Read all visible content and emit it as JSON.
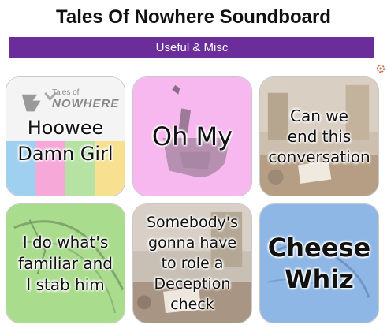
{
  "header": {
    "title": "Tales Of Nowhere Soundboard"
  },
  "category": {
    "label": "Useful & Misc"
  },
  "tiles": [
    {
      "label": "Hoowee\nDamn Girl",
      "logo_text": "Tales of",
      "logo_word": "NOWHERE"
    },
    {
      "label": "Oh My"
    },
    {
      "label": "Can we\nend this\nconversation"
    },
    {
      "label": "I do what's\nfamiliar and\nI stab him"
    },
    {
      "label": "Somebody's\ngonna have\nto role a\nDeception\ncheck"
    },
    {
      "label": "Cheese\nWhiz"
    }
  ],
  "colors": {
    "category_bar": "#6b2d9a",
    "tile_pink": "#f6b8ee",
    "tile_green": "#a9dc8c",
    "tile_blue": "#8eb7e6"
  },
  "icons": {
    "settings": "gear-icon"
  }
}
